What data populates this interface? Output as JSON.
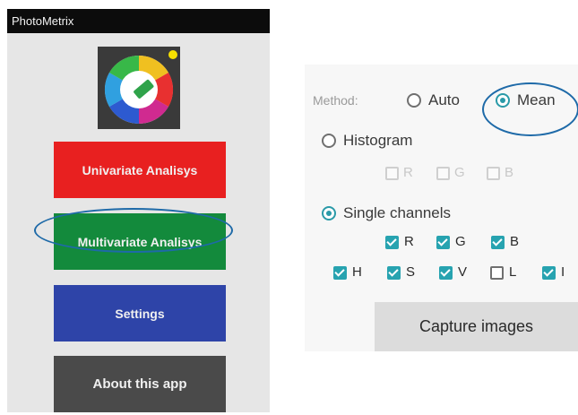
{
  "app": {
    "title": "PhotoMetrix"
  },
  "menu": {
    "univariate_label": "Univariate Analisys",
    "multivariate_label": "Multivariate Analisys",
    "settings_label": "Settings",
    "about_label": "About this app"
  },
  "settings": {
    "method_label": "Method:",
    "method_options": [
      {
        "label": "Auto",
        "selected": false
      },
      {
        "label": "Mean",
        "selected": true
      },
      {
        "label": "Histogram",
        "selected": false
      },
      {
        "label": "Single channels",
        "selected": true
      }
    ],
    "histogram_channels": [
      {
        "label": "R",
        "enabled": false,
        "checked": false
      },
      {
        "label": "G",
        "enabled": false,
        "checked": false
      },
      {
        "label": "B",
        "enabled": false,
        "checked": false
      }
    ],
    "single_channels": [
      {
        "label": "R",
        "checked": true
      },
      {
        "label": "G",
        "checked": true
      },
      {
        "label": "B",
        "checked": true
      },
      {
        "label": "H",
        "checked": true
      },
      {
        "label": "S",
        "checked": true
      },
      {
        "label": "V",
        "checked": true
      },
      {
        "label": "L",
        "checked": false
      },
      {
        "label": "I",
        "checked": true
      }
    ],
    "capture_label": "Capture images"
  },
  "colors": {
    "univariate": "#e82020",
    "multivariate": "#138a3c",
    "settings": "#2e44a8",
    "about": "#4a4a4a",
    "accent": "#27a3b0",
    "annotation": "#1e6aa8"
  }
}
